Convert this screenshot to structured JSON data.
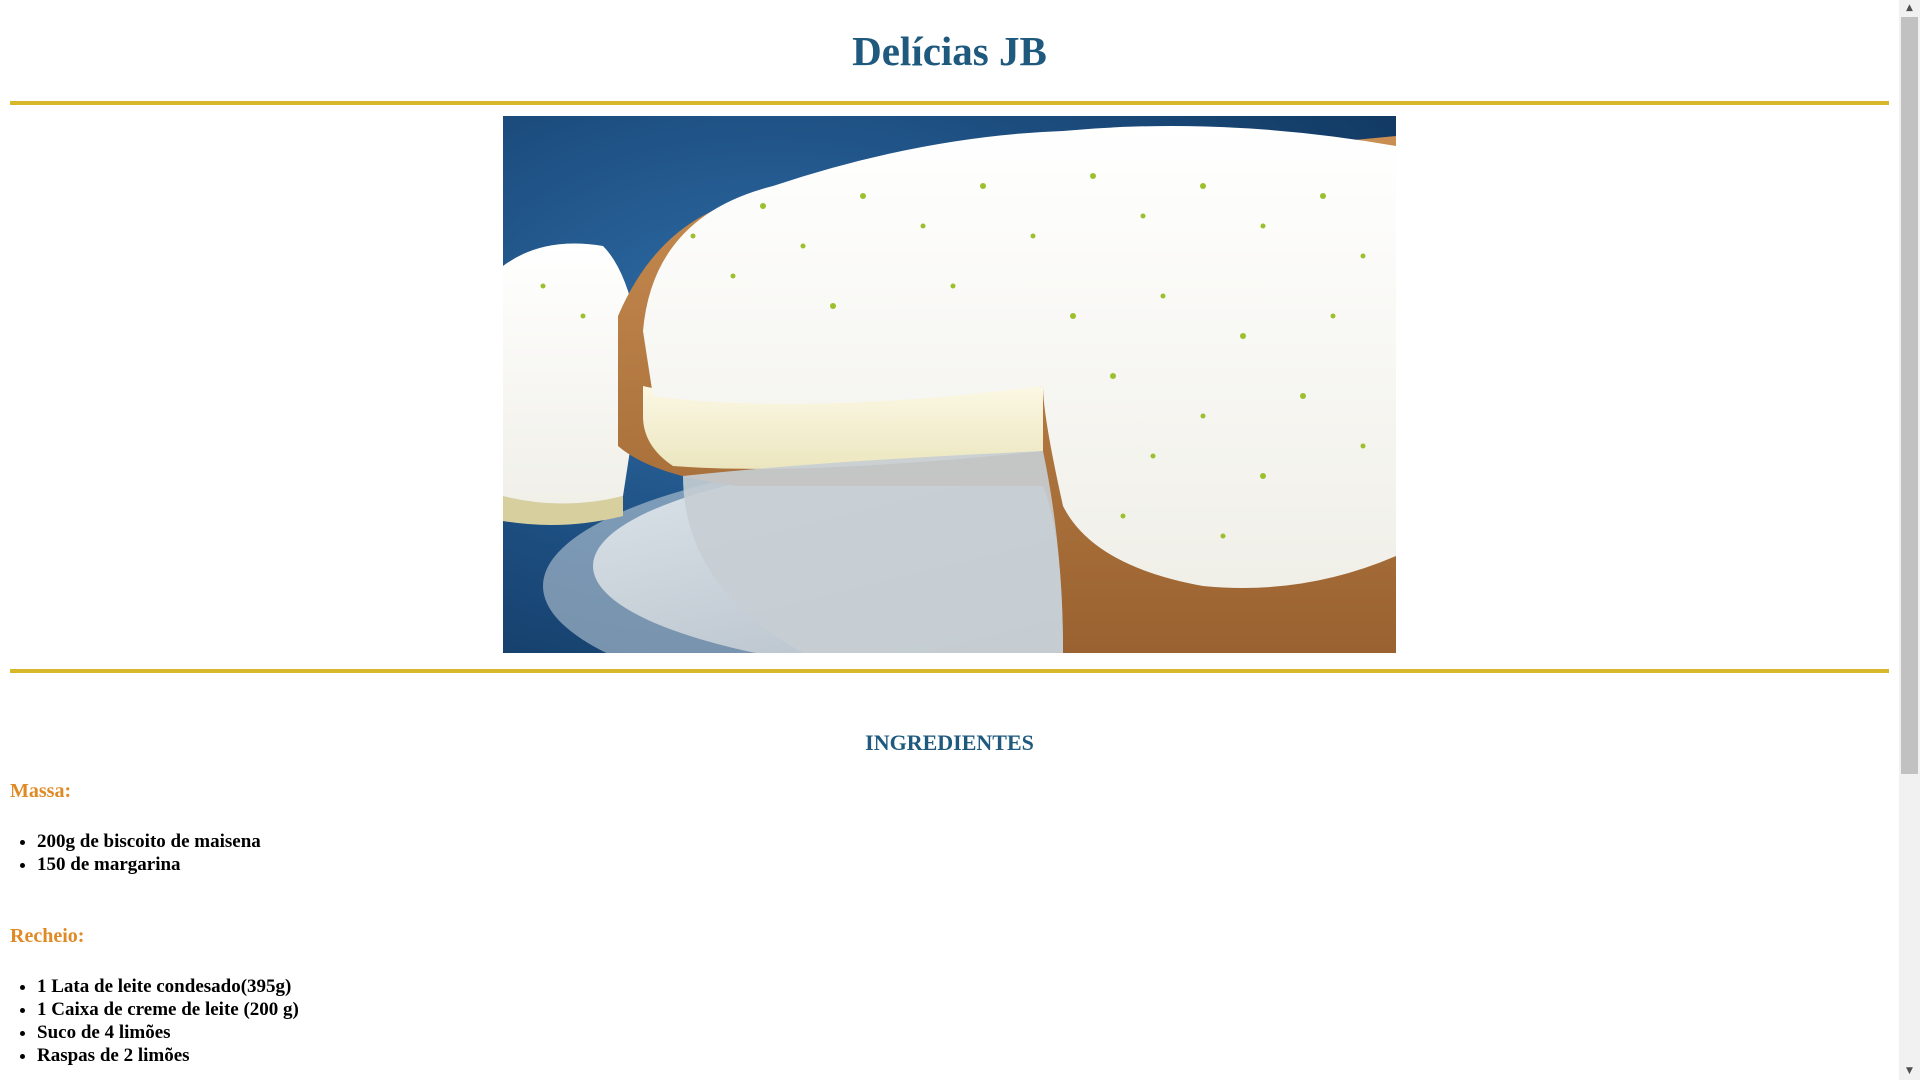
{
  "header": {
    "title": "Delícias JB"
  },
  "hero_image": {
    "alt": "Torta de limão",
    "icon": "lemon-pie-photo"
  },
  "ingredients": {
    "heading": "INGREDIENTES",
    "massa": {
      "label": "Massa:",
      "items": [
        "200g de biscoito de maisena",
        "150 de margarina"
      ]
    },
    "recheio": {
      "label": "Recheio:",
      "items": [
        "1 Lata de leite condesado(395g)",
        "1 Caixa de creme de leite (200 g)",
        "Suco de 4 limões",
        "Raspas de 2 limões"
      ]
    }
  },
  "scrollbar": {
    "up_arrow": "▲",
    "down_arrow": "▼"
  },
  "colors": {
    "title": "#1f5a7e",
    "rule": "#d6b82a",
    "subheading": "#e08a26"
  }
}
